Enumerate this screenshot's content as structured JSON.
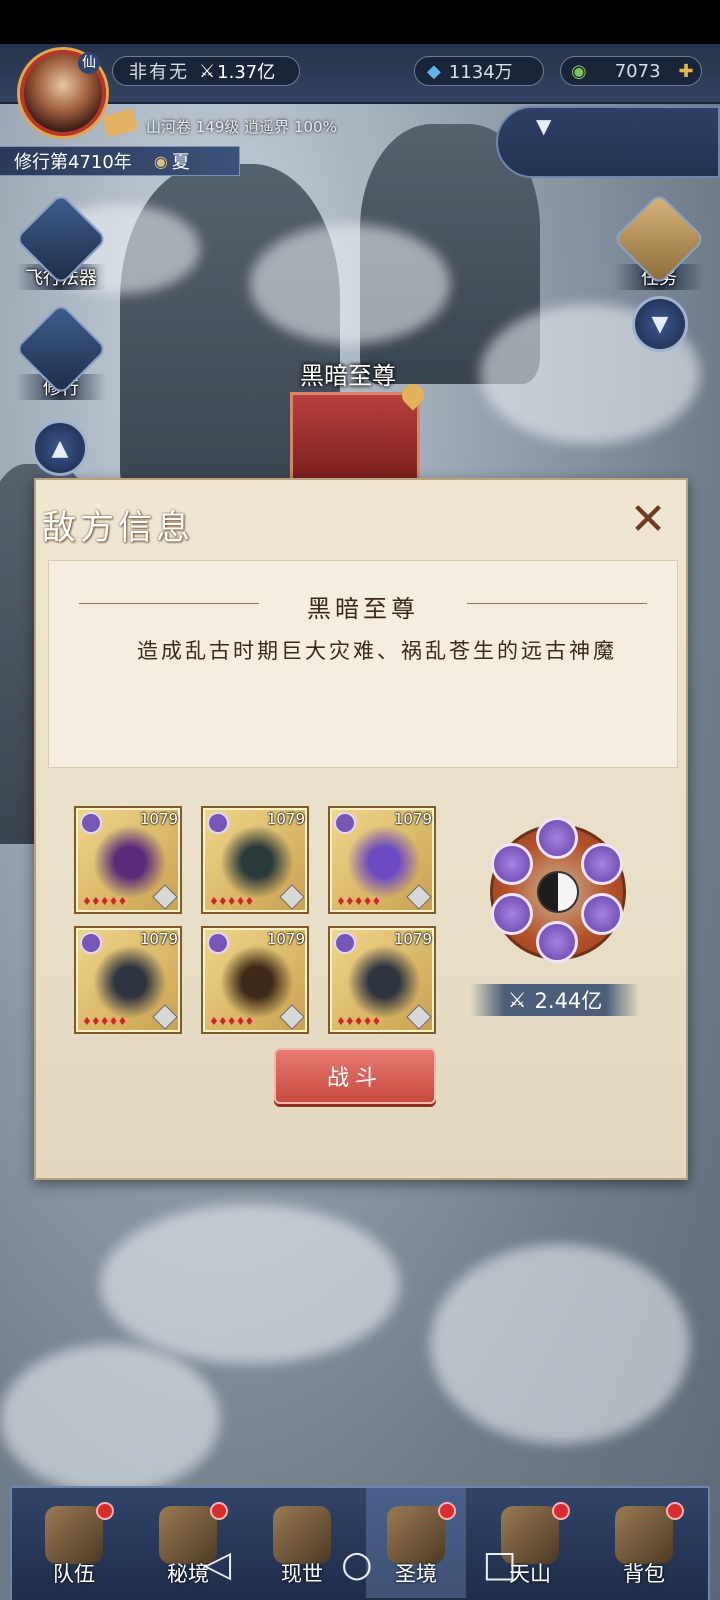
{
  "player": {
    "name": "非有无",
    "power": "1.37亿",
    "avatar_badge": "仙",
    "realm_info": "山河卷 149级 逍遥界 100%",
    "cultivation_year": "修行第4710年",
    "season": "夏"
  },
  "currency": {
    "crystal": "1134万",
    "jade": "7073"
  },
  "side_buttons": {
    "flight_artifact": "飞行法器",
    "cultivate": "修行",
    "tasks": "任务"
  },
  "map": {
    "boss_label": "黑暗至尊"
  },
  "dialog": {
    "title": "敌方信息",
    "close_icon": "close-icon",
    "enemy_name": "黑暗至尊",
    "description": "造成乱古时期巨大灾难、祸乱苍生的远古神魔",
    "units": [
      {
        "level": "1079",
        "kind": "axe"
      },
      {
        "level": "1079",
        "kind": "dark-lord"
      },
      {
        "level": "1079",
        "kind": "purple-vase"
      },
      {
        "level": "1079",
        "kind": "armored-knight"
      },
      {
        "level": "1079",
        "kind": "gold-orb"
      },
      {
        "level": "1079",
        "kind": "armored-knight"
      }
    ],
    "enemy_power": "2.44亿",
    "fight_label": "战斗"
  },
  "bottom_nav": [
    {
      "label": "队伍",
      "icon": "team-icon",
      "dot": true
    },
    {
      "label": "秘境",
      "icon": "secret-realm-icon",
      "dot": true
    },
    {
      "label": "现世",
      "icon": "world-icon",
      "dot": false
    },
    {
      "label": "圣境",
      "icon": "holy-realm-icon",
      "dot": true
    },
    {
      "label": "天山",
      "icon": "mountain-icon",
      "dot": true
    },
    {
      "label": "背包",
      "icon": "bag-icon",
      "dot": true
    }
  ],
  "system_nav": {
    "back": "◁",
    "home": "○",
    "recents": "□"
  }
}
